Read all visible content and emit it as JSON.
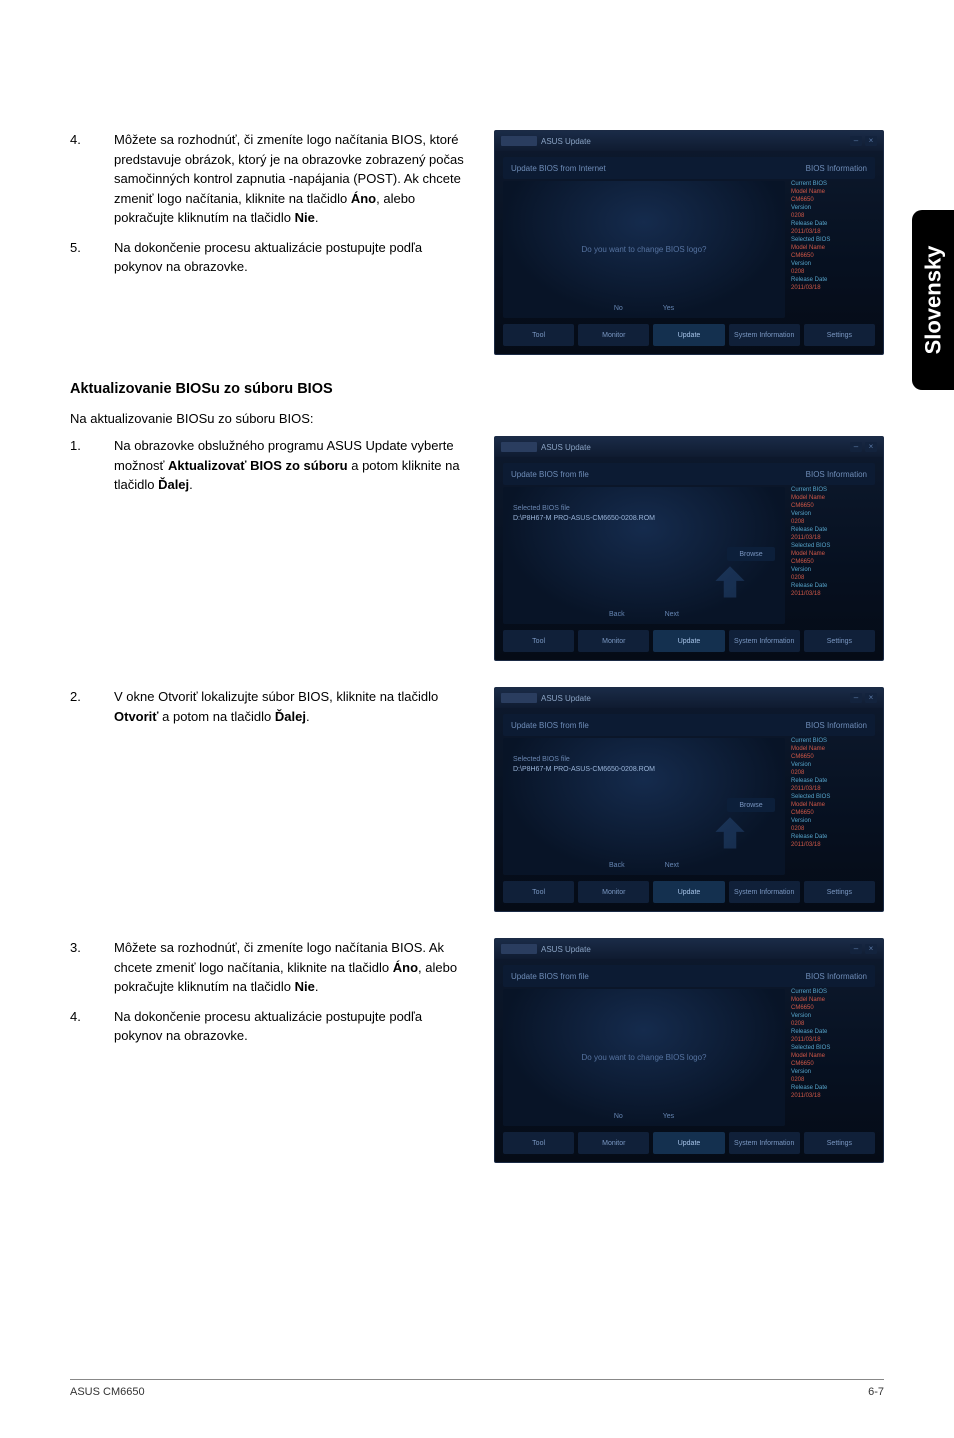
{
  "side_tab": "Slovensky",
  "section1": {
    "items": [
      {
        "num": "4.",
        "body_parts": [
          {
            "t": "Môžete sa rozhodnúť, či zmeníte logo načítania BIOS, ktoré predstavuje obrázok, ktorý je na obrazovke zobrazený počas samočinných kontrol zapnutia -napájania (POST). Ak chcete zmeniť logo načítania, kliknite na tlačidlo ",
            "b": false
          },
          {
            "t": "Áno",
            "b": true
          },
          {
            "t": ", alebo pokračujte kliknutím na tlačidlo ",
            "b": false
          },
          {
            "t": "Nie",
            "b": true
          },
          {
            "t": ".",
            "b": false
          }
        ]
      },
      {
        "num": "5.",
        "body_parts": [
          {
            "t": "Na dokončenie procesu aktualizácie postupujte podľa pokynov na obrazovke.",
            "b": false
          }
        ]
      }
    ]
  },
  "heading2": "Aktualizovanie BIOSu zo súboru BIOS",
  "intro2": "Na aktualizovanie BIOSu zo súboru BIOS:",
  "section2": {
    "items": [
      {
        "num": "1.",
        "body_parts": [
          {
            "t": "Na obrazovke obslužného programu ASUS Update vyberte možnosť ",
            "b": false
          },
          {
            "t": "Aktualizovať BIOS zo súboru",
            "b": true
          },
          {
            "t": " a potom kliknite na tlačidlo ",
            "b": false
          },
          {
            "t": "Ďalej",
            "b": true
          },
          {
            "t": ".",
            "b": false
          }
        ]
      }
    ]
  },
  "section3": {
    "items": [
      {
        "num": "2.",
        "body_parts": [
          {
            "t": "V okne Otvoriť lokalizujte súbor BIOS, kliknite na tlačidlo ",
            "b": false
          },
          {
            "t": "Otvoriť",
            "b": true
          },
          {
            "t": " a potom na tlačidlo ",
            "b": false
          },
          {
            "t": "Ďalej",
            "b": true
          },
          {
            "t": ".",
            "b": false
          }
        ]
      }
    ]
  },
  "section4": {
    "items": [
      {
        "num": "3.",
        "body_parts": [
          {
            "t": "Môžete sa rozhodnúť, či zmeníte logo načítania BIOS. Ak chcete zmeniť logo načítania, kliknite na tlačidlo ",
            "b": false
          },
          {
            "t": "Áno",
            "b": true
          },
          {
            "t": ", alebo pokračujte kliknutím na tlačidlo ",
            "b": false
          },
          {
            "t": "Nie",
            "b": true
          },
          {
            "t": ".",
            "b": false
          }
        ]
      },
      {
        "num": "4.",
        "body_parts": [
          {
            "t": "Na dokončenie procesu aktualizácie postupujte podľa pokynov na obrazovke.",
            "b": false
          }
        ]
      }
    ]
  },
  "shots": {
    "common": {
      "titlebar_text": "ASUS Update",
      "min": "–",
      "close": "×",
      "side_info_label": "BIOS Information",
      "nav": [
        "Tool",
        "Monitor",
        "Update",
        "System Information",
        "Settings"
      ],
      "active_nav": 2,
      "side_entries": [
        {
          "lbl": "Current BIOS",
          "cls": "side-val-blue"
        },
        {
          "lbl": "Model Name",
          "cls": "side-val-red"
        },
        {
          "lbl": "CM6650",
          "cls": "side-val-red"
        },
        {
          "lbl": "Version",
          "cls": "side-val-blue"
        },
        {
          "lbl": "0208",
          "cls": "side-val-red"
        },
        {
          "lbl": "Release Date",
          "cls": "side-val-blue"
        },
        {
          "lbl": "2011/03/18",
          "cls": "side-val-red"
        },
        {
          "lbl": "Selected BIOS",
          "cls": "side-val-blue"
        },
        {
          "lbl": "Model Name",
          "cls": "side-val-red"
        },
        {
          "lbl": "CM6650",
          "cls": "side-val-red"
        },
        {
          "lbl": "Version",
          "cls": "side-val-blue"
        },
        {
          "lbl": "0208",
          "cls": "side-val-red"
        },
        {
          "lbl": "Release Date",
          "cls": "side-val-blue"
        },
        {
          "lbl": "2011/03/18",
          "cls": "side-val-red"
        }
      ]
    },
    "shot1": {
      "subbar_left": "Update BIOS from Internet",
      "center_text": "Do you want to change BIOS logo?",
      "mini_nav": [
        "No",
        "Yes"
      ]
    },
    "shot2": {
      "subbar_left": "Update BIOS from file",
      "path_lbl": "Selected BIOS file",
      "path": "D:\\P8H67-M PRO-ASUS-CM6650-0208.ROM",
      "browse": "Browse",
      "mini_nav": [
        "Back",
        "Next"
      ]
    },
    "shot3": {
      "subbar_left": "Update BIOS from file",
      "path_lbl": "Selected BIOS file",
      "path": "D:\\P8H67-M PRO-ASUS-CM6650-0208.ROM",
      "browse": "Browse",
      "mini_nav": [
        "Back",
        "Next"
      ]
    },
    "shot4": {
      "subbar_left": "Update BIOS from file",
      "center_text": "Do you want to change BIOS logo?",
      "mini_nav": [
        "No",
        "Yes"
      ]
    }
  },
  "footer": {
    "left": "ASUS CM6650",
    "right": "6-7"
  }
}
